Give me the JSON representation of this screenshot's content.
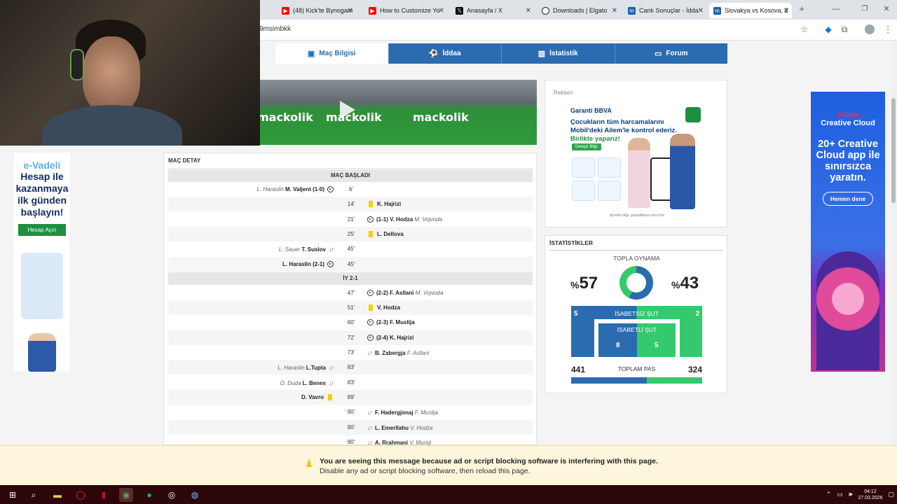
{
  "browser": {
    "tabs": [
      {
        "label": "(48) Kick'te Bynogam",
        "icon": "youtube-icon",
        "color": "#ff0000"
      },
      {
        "label": "How to Customize Yo",
        "icon": "youtube-icon",
        "color": "#ff0000"
      },
      {
        "label": "Anasayfa / X",
        "icon": "x-icon",
        "color": "#000000"
      },
      {
        "label": "Downloads | Elgato",
        "icon": "elgato-icon",
        "color": "#222222"
      },
      {
        "label": "Canlı Sonuçlar - İdda",
        "icon": "mackolik-icon",
        "color": "#1e5fae"
      },
      {
        "label": "Slovakya vs Kosova, 2",
        "icon": "mackolik-icon",
        "color": "#1e5fae"
      }
    ],
    "url": "9msimbkk"
  },
  "match_tabs": [
    {
      "label": "Maç Bilgisi",
      "icon": "info-icon"
    },
    {
      "label": "İddaa",
      "icon": "ball-icon"
    },
    {
      "label": "İstatistik",
      "icon": "chart-icon"
    },
    {
      "label": "Forum",
      "icon": "chat-icon"
    }
  ],
  "video": {
    "brand": "mackolik"
  },
  "left_ad": {
    "line1": "e-Vadeli",
    "line2": "Hesap ile kazanmaya ilk günden başlayın!",
    "button": "Hesap Açın"
  },
  "detail": {
    "title": "MAÇ DETAY",
    "start_label": "MAÇ BAŞLADI",
    "half_label": "İY 2-1",
    "events_first": [
      {
        "minute": "6'",
        "side": "home",
        "type": "goal",
        "assist": "L. Haraslin",
        "player": "M. Valjent (1-0)"
      },
      {
        "minute": "14'",
        "side": "away",
        "type": "yellow",
        "player": "K. Hajrizi"
      },
      {
        "minute": "21'",
        "side": "away",
        "type": "goal",
        "player": "(1-1) V. Hodza",
        "assist": "M. Vojvoda"
      },
      {
        "minute": "25'",
        "side": "away",
        "type": "yellow",
        "player": "L. Dellova"
      },
      {
        "minute": "45'",
        "side": "home",
        "type": "sub",
        "assist": "L. Sauer",
        "player": "T. Suslov"
      },
      {
        "minute": "45'",
        "side": "home",
        "type": "goal",
        "player": "L. Haraslin (2-1)"
      }
    ],
    "events_second": [
      {
        "minute": "47'",
        "side": "away",
        "type": "goal",
        "player": "(2-2) F. Asllani",
        "assist": "M. Vojvoda"
      },
      {
        "minute": "51'",
        "side": "away",
        "type": "yellow",
        "player": "V. Hodza"
      },
      {
        "minute": "60'",
        "side": "away",
        "type": "goal",
        "player": "(2-3) F. Muslija"
      },
      {
        "minute": "72'",
        "side": "away",
        "type": "goal",
        "player": "(2-4) K. Hajrizi"
      },
      {
        "minute": "73'",
        "side": "away",
        "type": "sub",
        "player": "B. Zabergja",
        "assist": "F. Asllani"
      },
      {
        "minute": "83'",
        "side": "home",
        "type": "sub",
        "assist": "L. Haraslin",
        "player": "L.Tupta"
      },
      {
        "minute": "83'",
        "side": "home",
        "type": "sub",
        "assist": "O. Duda",
        "player": "L. Benes"
      },
      {
        "minute": "89'",
        "side": "home",
        "type": "yellow",
        "player": "D. Vavro"
      },
      {
        "minute": "90'",
        "side": "away",
        "type": "sub",
        "player": "F. Hadergjonaj",
        "assist": "F. Muslija"
      },
      {
        "minute": "90'",
        "side": "away",
        "type": "sub",
        "player": "L. Emerllahu",
        "assist": "V. Hodza"
      },
      {
        "minute": "90'",
        "side": "away",
        "type": "sub",
        "player": "A. Rrahmani",
        "assist": "V. Muriqi"
      }
    ]
  },
  "right_ad": {
    "label": "Reklam",
    "brand": "Garanti BBVA",
    "title": "Çocukların tüm harcamalarını Mobil'deki Ailem'le kontrol ederiz.",
    "title2": "Birlikte yaparız!",
    "button": "Detaylı Bilgi",
    "footer": "Ayrıntılı bilgi: garantibbva.com.tr'de"
  },
  "stats": {
    "title": "İSTATİSTİKLER",
    "possession_label": "TOPLA OYNAMA",
    "possession_home": 57,
    "possession_away": 43,
    "percent_prefix": "%",
    "shots_off_label": "İSABETSİZ ŞUT",
    "shots_off_home": "5",
    "shots_off_away": "2",
    "shots_on_label": "İSABETLİ ŞUT",
    "shots_on_home": "8",
    "shots_on_away": "5",
    "passes_label": "TOPLAM PAS",
    "passes_home": "441",
    "passes_away": "324",
    "colors": {
      "home": "#2b6cb0",
      "away": "#35c96d"
    }
  },
  "adobe_ad": {
    "brand1": "Adobe",
    "brand2": "Creative Cloud",
    "headline": "20+ Creative Cloud app ile sınırsızca yaratın.",
    "button": "Hemen dene"
  },
  "adblock": {
    "message": "You are seeing this message because ad or script blocking software is interfering with this page.",
    "instruction": "Disable any ad or script blocking software, then reload this page."
  },
  "taskbar": {
    "time": "04:12",
    "date": "27.03.2026"
  }
}
